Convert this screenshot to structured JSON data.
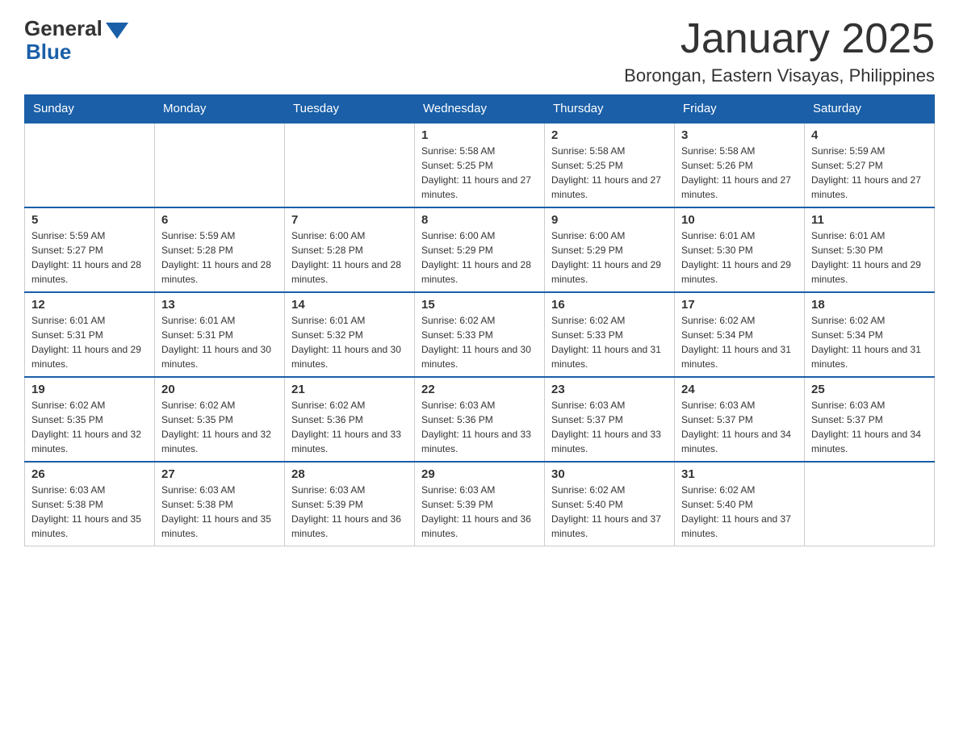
{
  "logo": {
    "general": "General",
    "blue": "Blue"
  },
  "header": {
    "title": "January 2025",
    "subtitle": "Borongan, Eastern Visayas, Philippines"
  },
  "days_of_week": [
    "Sunday",
    "Monday",
    "Tuesday",
    "Wednesday",
    "Thursday",
    "Friday",
    "Saturday"
  ],
  "weeks": [
    [
      {
        "day": "",
        "info": ""
      },
      {
        "day": "",
        "info": ""
      },
      {
        "day": "",
        "info": ""
      },
      {
        "day": "1",
        "info": "Sunrise: 5:58 AM\nSunset: 5:25 PM\nDaylight: 11 hours and 27 minutes."
      },
      {
        "day": "2",
        "info": "Sunrise: 5:58 AM\nSunset: 5:25 PM\nDaylight: 11 hours and 27 minutes."
      },
      {
        "day": "3",
        "info": "Sunrise: 5:58 AM\nSunset: 5:26 PM\nDaylight: 11 hours and 27 minutes."
      },
      {
        "day": "4",
        "info": "Sunrise: 5:59 AM\nSunset: 5:27 PM\nDaylight: 11 hours and 27 minutes."
      }
    ],
    [
      {
        "day": "5",
        "info": "Sunrise: 5:59 AM\nSunset: 5:27 PM\nDaylight: 11 hours and 28 minutes."
      },
      {
        "day": "6",
        "info": "Sunrise: 5:59 AM\nSunset: 5:28 PM\nDaylight: 11 hours and 28 minutes."
      },
      {
        "day": "7",
        "info": "Sunrise: 6:00 AM\nSunset: 5:28 PM\nDaylight: 11 hours and 28 minutes."
      },
      {
        "day": "8",
        "info": "Sunrise: 6:00 AM\nSunset: 5:29 PM\nDaylight: 11 hours and 28 minutes."
      },
      {
        "day": "9",
        "info": "Sunrise: 6:00 AM\nSunset: 5:29 PM\nDaylight: 11 hours and 29 minutes."
      },
      {
        "day": "10",
        "info": "Sunrise: 6:01 AM\nSunset: 5:30 PM\nDaylight: 11 hours and 29 minutes."
      },
      {
        "day": "11",
        "info": "Sunrise: 6:01 AM\nSunset: 5:30 PM\nDaylight: 11 hours and 29 minutes."
      }
    ],
    [
      {
        "day": "12",
        "info": "Sunrise: 6:01 AM\nSunset: 5:31 PM\nDaylight: 11 hours and 29 minutes."
      },
      {
        "day": "13",
        "info": "Sunrise: 6:01 AM\nSunset: 5:31 PM\nDaylight: 11 hours and 30 minutes."
      },
      {
        "day": "14",
        "info": "Sunrise: 6:01 AM\nSunset: 5:32 PM\nDaylight: 11 hours and 30 minutes."
      },
      {
        "day": "15",
        "info": "Sunrise: 6:02 AM\nSunset: 5:33 PM\nDaylight: 11 hours and 30 minutes."
      },
      {
        "day": "16",
        "info": "Sunrise: 6:02 AM\nSunset: 5:33 PM\nDaylight: 11 hours and 31 minutes."
      },
      {
        "day": "17",
        "info": "Sunrise: 6:02 AM\nSunset: 5:34 PM\nDaylight: 11 hours and 31 minutes."
      },
      {
        "day": "18",
        "info": "Sunrise: 6:02 AM\nSunset: 5:34 PM\nDaylight: 11 hours and 31 minutes."
      }
    ],
    [
      {
        "day": "19",
        "info": "Sunrise: 6:02 AM\nSunset: 5:35 PM\nDaylight: 11 hours and 32 minutes."
      },
      {
        "day": "20",
        "info": "Sunrise: 6:02 AM\nSunset: 5:35 PM\nDaylight: 11 hours and 32 minutes."
      },
      {
        "day": "21",
        "info": "Sunrise: 6:02 AM\nSunset: 5:36 PM\nDaylight: 11 hours and 33 minutes."
      },
      {
        "day": "22",
        "info": "Sunrise: 6:03 AM\nSunset: 5:36 PM\nDaylight: 11 hours and 33 minutes."
      },
      {
        "day": "23",
        "info": "Sunrise: 6:03 AM\nSunset: 5:37 PM\nDaylight: 11 hours and 33 minutes."
      },
      {
        "day": "24",
        "info": "Sunrise: 6:03 AM\nSunset: 5:37 PM\nDaylight: 11 hours and 34 minutes."
      },
      {
        "day": "25",
        "info": "Sunrise: 6:03 AM\nSunset: 5:37 PM\nDaylight: 11 hours and 34 minutes."
      }
    ],
    [
      {
        "day": "26",
        "info": "Sunrise: 6:03 AM\nSunset: 5:38 PM\nDaylight: 11 hours and 35 minutes."
      },
      {
        "day": "27",
        "info": "Sunrise: 6:03 AM\nSunset: 5:38 PM\nDaylight: 11 hours and 35 minutes."
      },
      {
        "day": "28",
        "info": "Sunrise: 6:03 AM\nSunset: 5:39 PM\nDaylight: 11 hours and 36 minutes."
      },
      {
        "day": "29",
        "info": "Sunrise: 6:03 AM\nSunset: 5:39 PM\nDaylight: 11 hours and 36 minutes."
      },
      {
        "day": "30",
        "info": "Sunrise: 6:02 AM\nSunset: 5:40 PM\nDaylight: 11 hours and 37 minutes."
      },
      {
        "day": "31",
        "info": "Sunrise: 6:02 AM\nSunset: 5:40 PM\nDaylight: 11 hours and 37 minutes."
      },
      {
        "day": "",
        "info": ""
      }
    ]
  ]
}
